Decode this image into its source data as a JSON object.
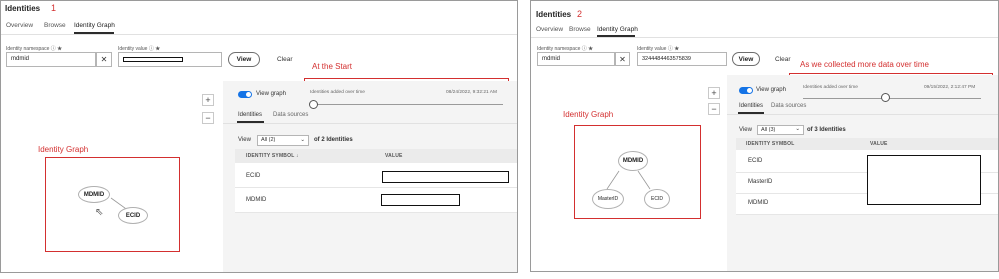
{
  "panel1": {
    "title": "Identities",
    "number": "1",
    "tabs": [
      "Overview",
      "Browse",
      "Identity Graph"
    ],
    "namespace_label": "Identity namespace ⓘ ★",
    "namespace_value": "mdmid",
    "value_label": "Identity value ⓘ ★",
    "view_button": "View",
    "clear_button": "Clear",
    "annotation_start": "At the Start",
    "annotation_graph": "Identity Graph",
    "view_graph_label": "View graph",
    "identities_added": "Identities added over time",
    "timestamp": "08/24/2022, 9:32:21 AM",
    "subtabs": [
      "Identities",
      "Data sources"
    ],
    "view_label": "View",
    "select_value": "All (2)",
    "of_count": "of 2 Identities",
    "columns": [
      "IDENTITY SYMBOL ↓",
      "VALUE"
    ],
    "rows": [
      "ECID",
      "MDMID"
    ],
    "nodes": [
      "MDMID",
      "ECID"
    ],
    "zoom": [
      "+",
      "−"
    ]
  },
  "panel2": {
    "title": "Identities",
    "number": "2",
    "tabs": [
      "Overview",
      "Browse",
      "Identity Graph"
    ],
    "namespace_label": "Identity namespace ⓘ ★",
    "namespace_value": "mdmid",
    "value_label": "Identity value ⓘ ★",
    "value_text": "3244484463575839",
    "view_button": "View",
    "clear_button": "Clear",
    "annotation_more": "As we collected more data over time",
    "annotation_graph": "Identity Graph",
    "view_graph_label": "View graph",
    "identities_added": "Identities added over time",
    "timestamp": "09/15/2022, 2:12:47 PM",
    "subtabs": [
      "Identities",
      "Data sources"
    ],
    "view_label": "View",
    "select_value": "All (3)",
    "of_count": "of 3 Identities",
    "columns": [
      "IDENTITY SYMBOL",
      "VALUE"
    ],
    "rows": [
      "ECID",
      "MasterID",
      "MDMID"
    ],
    "nodes": [
      "MDMID",
      "MasterID",
      "ECID"
    ],
    "zoom": [
      "+",
      "−"
    ]
  }
}
